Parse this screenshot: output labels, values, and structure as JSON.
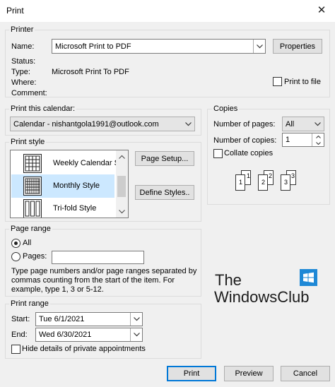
{
  "window": {
    "title": "Print",
    "close_glyph": "✕"
  },
  "printer": {
    "legend": "Printer",
    "name_label": "Name:",
    "name_value": "Microsoft Print to PDF",
    "properties_label": "Properties",
    "status_label": "Status:",
    "type_label": "Type:",
    "type_value": "Microsoft Print To PDF",
    "where_label": "Where:",
    "comment_label": "Comment:",
    "print_to_file_label": "Print to file",
    "print_to_file_checked": false
  },
  "calendar": {
    "legend": "Print this calendar:",
    "value": "Calendar - nishantgola1991@outlook.com"
  },
  "print_style": {
    "legend": "Print style",
    "items": [
      {
        "label": "Weekly Calendar S",
        "icon": "weekly-calendar-icon"
      },
      {
        "label": "Monthly Style",
        "icon": "monthly-calendar-icon",
        "selected": true
      },
      {
        "label": "Tri-fold Style",
        "icon": "trifold-calendar-icon"
      }
    ],
    "page_setup_label": "Page Setup...",
    "define_styles_label": "Define Styles.."
  },
  "page_range": {
    "legend": "Page range",
    "all_label": "All",
    "pages_label": "Pages:",
    "pages_value": "",
    "selected": "All",
    "help_line1": "Type page numbers and/or page ranges separated by",
    "help_line2": "commas counting from the start of the item.  For",
    "help_line3": "example, type 1, 3 or 5-12."
  },
  "print_range": {
    "legend": "Print range",
    "start_label": "Start:",
    "start_value": "Tue 6/1/2021",
    "end_label": "End:",
    "end_value": "Wed 6/30/2021",
    "hide_private_label": "Hide details of private appointments",
    "hide_private_checked": false
  },
  "copies": {
    "legend": "Copies",
    "num_pages_label": "Number of pages:",
    "num_pages_value": "All",
    "num_copies_label": "Number of copies:",
    "num_copies_value": "1",
    "collate_label": "Collate copies",
    "collate_checked": false,
    "collate_digits": [
      "1",
      "1",
      "2",
      "2",
      "3",
      "3"
    ]
  },
  "watermark": {
    "line1": "The",
    "line2": "WindowsClub"
  },
  "buttons": {
    "print": "Print",
    "preview": "Preview",
    "cancel": "Cancel"
  },
  "colors": {
    "accent": "#0078d7",
    "selection": "#cce8ff"
  }
}
